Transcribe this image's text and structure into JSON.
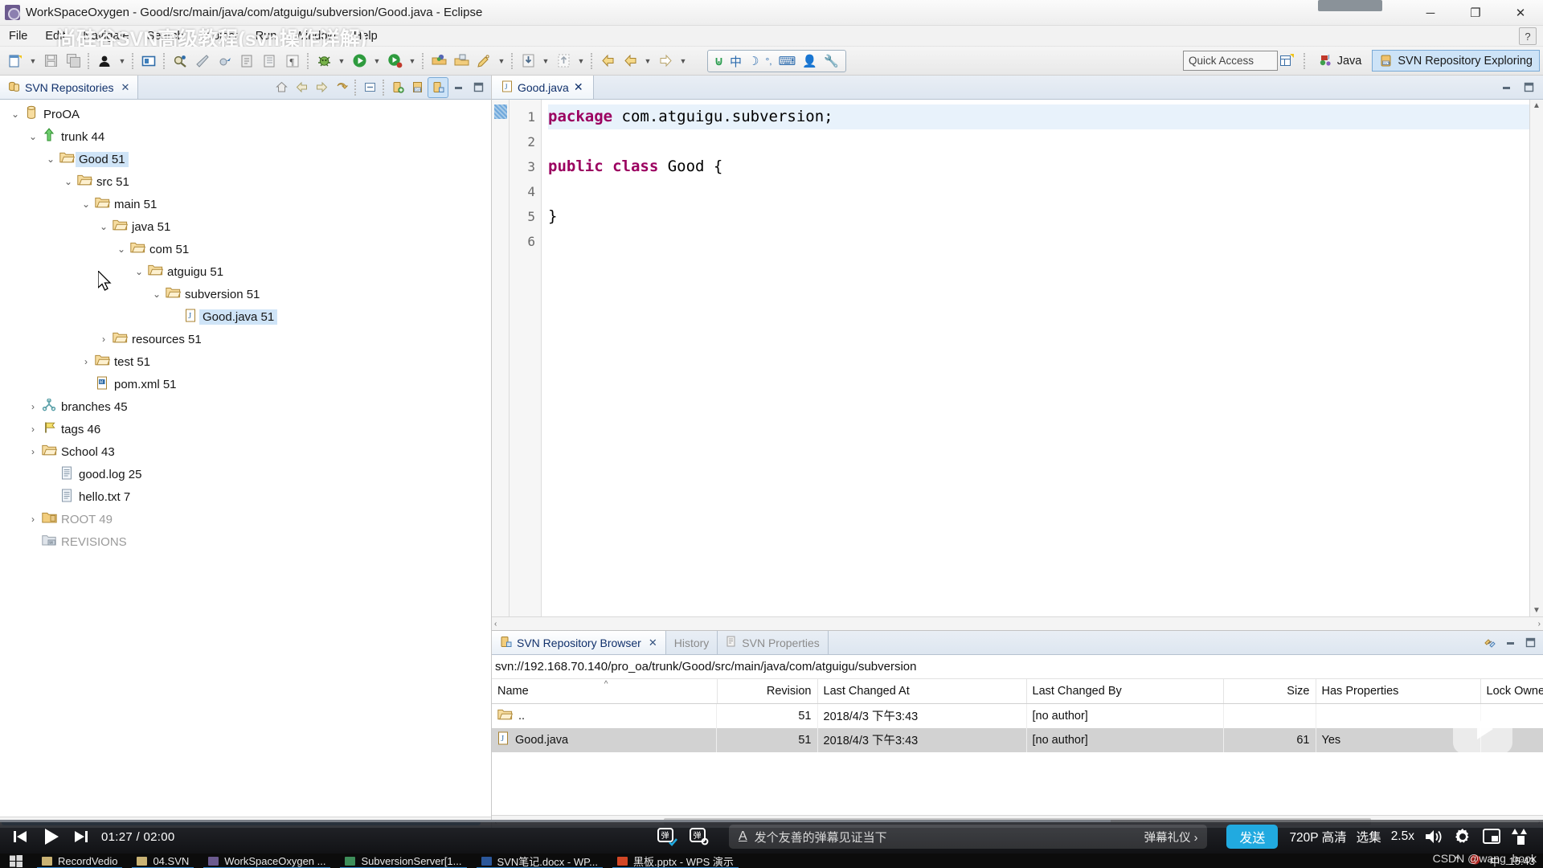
{
  "window": {
    "title": "WorkSpaceOxygen - Good/src/main/java/com/atguigu/subversion/Good.java - Eclipse",
    "app_icon": "eclipse-icon",
    "minimize_label": "─",
    "restore_label": "❐",
    "close_label": "✕"
  },
  "watermark": {
    "overlay_title": "尚硅谷SVN高级教程(svn操作详解)",
    "csdn": "CSDN @wang_book"
  },
  "menu": {
    "items": [
      "File",
      "Edit",
      "Navigate",
      "Search",
      "Project",
      "Run",
      "Window",
      "Help"
    ],
    "help_icon": "question-mark-icon"
  },
  "toolbar": {
    "groups": [
      [
        "new-wizard-icon",
        "dropdown-arrow",
        "save-icon",
        "save-all-icon"
      ],
      [
        "debug-person-icon",
        "dropdown-arrow"
      ],
      [
        "open-type-icon"
      ],
      [
        "search-icon",
        "annotate-icon",
        "skip-breakpoints-icon",
        "next-annotation-icon",
        "previous-annotation-icon",
        "pilcrow-icon"
      ],
      [
        "debug-bug-icon",
        "dropdown-arrow",
        "run-icon",
        "dropdown-arrow",
        "run-coverage-icon",
        "dropdown-arrow"
      ],
      [
        "new-java-package-icon",
        "new-java-class-icon",
        "new-annotation-icon",
        "dropdown-arrow"
      ],
      [
        "import-icon",
        "dropdown-arrow",
        "export-icon",
        "dropdown-arrow"
      ],
      [
        "back-icon",
        "forward-icon",
        "dropdown-arrow",
        "next-icon",
        "dropdown-arrow"
      ]
    ],
    "ime": {
      "name": "chinese-ime-toolbar",
      "glyphs": [
        "ime-logo-icon",
        "中",
        "☽",
        "°,",
        "keyboard-icon",
        "user-icon",
        "wrench-icon"
      ]
    },
    "quick_access": {
      "label": "Quick Access",
      "name": "quick-access-field"
    },
    "perspectives": {
      "open_perspective_icon": "open-perspective-icon",
      "items": [
        {
          "label": "Java",
          "icon": "java-perspective-icon",
          "active": false
        },
        {
          "label": "SVN Repository Exploring",
          "icon": "svn-perspective-icon",
          "active": true
        }
      ]
    }
  },
  "left_view": {
    "tab": {
      "label": "SVN Repositories",
      "icon": "svn-repositories-icon",
      "close": "✕"
    },
    "toolbar_icons": [
      "home-icon",
      "back-icon",
      "forward-icon",
      "refresh-icon",
      "collapse-all-icon",
      "new-repository-location-icon",
      "new-repository-icon",
      "show-in-browser-icon",
      "minimize-icon",
      "maximize-icon"
    ],
    "tree": [
      {
        "indent": 0,
        "twisty": "⌄",
        "icon": "repository-icon",
        "label": "ProOA",
        "selected": false,
        "dim": false
      },
      {
        "indent": 1,
        "twisty": "⌄",
        "icon": "trunk-icon",
        "label": "trunk 44",
        "selected": false,
        "dim": false
      },
      {
        "indent": 2,
        "twisty": "⌄",
        "icon": "folder-icon",
        "label": "Good 51",
        "selected": true,
        "dim": false
      },
      {
        "indent": 3,
        "twisty": "⌄",
        "icon": "folder-icon",
        "label": "src 51",
        "selected": false,
        "dim": false
      },
      {
        "indent": 4,
        "twisty": "⌄",
        "icon": "folder-icon",
        "label": "main 51",
        "selected": false,
        "dim": false
      },
      {
        "indent": 5,
        "twisty": "⌄",
        "icon": "folder-icon",
        "label": "java 51",
        "selected": false,
        "dim": false
      },
      {
        "indent": 6,
        "twisty": "⌄",
        "icon": "folder-icon",
        "label": "com 51",
        "selected": false,
        "dim": false
      },
      {
        "indent": 7,
        "twisty": "⌄",
        "icon": "folder-icon",
        "label": "atguigu 51",
        "selected": false,
        "dim": false
      },
      {
        "indent": 8,
        "twisty": "⌄",
        "icon": "folder-icon",
        "label": "subversion 51",
        "selected": false,
        "dim": false
      },
      {
        "indent": 9,
        "twisty": "",
        "icon": "java-file-icon",
        "label": "Good.java 51",
        "selected": true,
        "dim": false
      },
      {
        "indent": 5,
        "twisty": "›",
        "icon": "folder-icon",
        "label": "resources 51",
        "selected": false,
        "dim": false
      },
      {
        "indent": 4,
        "twisty": "›",
        "icon": "folder-icon",
        "label": "test 51",
        "selected": false,
        "dim": false
      },
      {
        "indent": 4,
        "twisty": "",
        "icon": "maven-file-icon",
        "label": "pom.xml 51",
        "selected": false,
        "dim": false
      },
      {
        "indent": 1,
        "twisty": "›",
        "icon": "branches-icon",
        "label": "branches 45",
        "selected": false,
        "dim": false
      },
      {
        "indent": 1,
        "twisty": "›",
        "icon": "tags-icon",
        "label": "tags 46",
        "selected": false,
        "dim": false
      },
      {
        "indent": 1,
        "twisty": "›",
        "icon": "folder-icon",
        "label": "School 43",
        "selected": false,
        "dim": false
      },
      {
        "indent": 2,
        "twisty": "",
        "icon": "text-file-icon",
        "label": "good.log 25",
        "selected": false,
        "dim": false
      },
      {
        "indent": 2,
        "twisty": "",
        "icon": "text-file-icon",
        "label": "hello.txt 7",
        "selected": false,
        "dim": false
      },
      {
        "indent": 1,
        "twisty": "›",
        "icon": "root-folder-icon",
        "label": "ROOT 49",
        "selected": false,
        "dim": true
      },
      {
        "indent": 1,
        "twisty": "",
        "icon": "revisions-icon",
        "label": "REVISIONS",
        "selected": false,
        "dim": true
      }
    ],
    "cursor": "mouse-pointer"
  },
  "editor": {
    "tab": {
      "label": "Good.java",
      "icon": "java-file-icon",
      "close": "✕"
    },
    "minimize_label": "─",
    "maximize_label": "❐",
    "lines": [
      {
        "no": "1",
        "current": true,
        "tokens": [
          {
            "t": "package",
            "k": true
          },
          {
            "t": " com.atguigu.subversion;",
            "k": false
          }
        ]
      },
      {
        "no": "2",
        "current": false,
        "tokens": []
      },
      {
        "no": "3",
        "current": false,
        "tokens": [
          {
            "t": "public class",
            "k": true
          },
          {
            "t": " Good {",
            "k": false
          }
        ]
      },
      {
        "no": "4",
        "current": false,
        "tokens": []
      },
      {
        "no": "5",
        "current": false,
        "tokens": [
          {
            "t": "}",
            "k": false
          }
        ]
      },
      {
        "no": "6",
        "current": false,
        "tokens": []
      }
    ]
  },
  "bottom_view": {
    "tabs": [
      {
        "label": "SVN Repository Browser",
        "icon": "svn-browser-icon",
        "active": true,
        "close": "✕"
      },
      {
        "label": "History",
        "icon": "",
        "active": false,
        "close": ""
      },
      {
        "label": "SVN Properties",
        "icon": "svn-properties-icon",
        "active": false,
        "close": ""
      }
    ],
    "toolbar_icons": [
      "link-with-editor-icon",
      "minimize-icon",
      "maximize-icon"
    ],
    "url": "svn://192.168.70.140/pro_oa/trunk/Good/src/main/java/com/atguigu/subversion",
    "columns": [
      "Name",
      "Revision",
      "Last Changed At",
      "Last Changed By",
      "Size",
      "Has Properties",
      "Lock Owner"
    ],
    "sort_column": "Name",
    "sort_caret": "^",
    "rows": [
      {
        "icon": "parent-folder-icon",
        "name": "..",
        "revision": "51",
        "changed_at": "2018/4/3 下午3:43",
        "changed_by": "[no author]",
        "size": "",
        "has_properties": "",
        "lock_owner": "",
        "selected": false
      },
      {
        "icon": "java-file-icon",
        "name": "Good.java",
        "revision": "51",
        "changed_at": "2018/4/3 下午3:43",
        "changed_by": "[no author]",
        "size": "61",
        "has_properties": "Yes",
        "lock_owner": "",
        "selected": true
      }
    ]
  },
  "player": {
    "progress_percent": 72,
    "prev_icon": "previous-track-icon",
    "play_icon": "play-icon",
    "next_icon": "next-track-icon",
    "time_current": "01:27",
    "time_total": "02:00",
    "time_display": "01:27 / 02:00",
    "danmaku_toggle_icon": "danmaku-on-icon",
    "danmaku_settings_icon": "danmaku-settings-icon",
    "input_font_icon": "font-style-icon",
    "input_placeholder": "发个友善的弹幕见证当下",
    "etiquette_label": "弹幕礼仪 ›",
    "send_label": "发送",
    "quality_label": "720P 高清",
    "episodes_label": "选集",
    "speed_label": "2.5x",
    "volume_icon": "volume-icon",
    "settings_icon": "gear-icon",
    "pip_icon": "picture-in-picture-icon",
    "fullscreen_icon": "widescreen-icon",
    "center_play_icon": "play-overlay-icon"
  },
  "taskbar": {
    "start_icon": "windows-start-icon",
    "items": [
      {
        "label": "RecordVedio",
        "icon": "folder-icon",
        "color": "#c9b273",
        "active": true
      },
      {
        "label": "04.SVN",
        "icon": "folder-icon",
        "color": "#c9b273",
        "active": true
      },
      {
        "label": "WorkSpaceOxygen ...",
        "icon": "eclipse-icon",
        "color": "#6b5a8e",
        "active": true
      },
      {
        "label": "SubversionServer[1...",
        "icon": "terminal-icon",
        "color": "#3e8e5a",
        "active": true
      },
      {
        "label": "SVN笔记.docx - WP...",
        "icon": "word-icon",
        "color": "#2b579a",
        "active": true
      },
      {
        "label": "黑板.pptx - WPS 演示",
        "icon": "ppt-icon",
        "color": "#d24726",
        "active": true
      }
    ],
    "tray": {
      "chevron": "⌃",
      "app_icon": "tray-app-icon",
      "ime_label": "中",
      "time": "15:43"
    }
  }
}
